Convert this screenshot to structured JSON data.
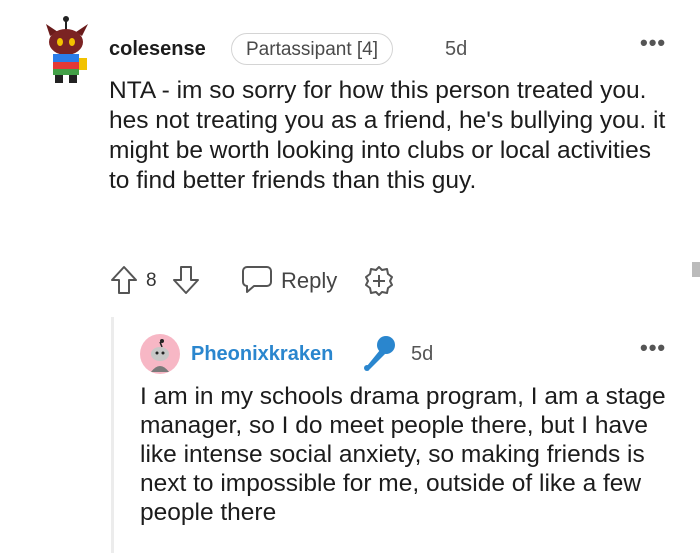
{
  "comments": [
    {
      "username": "colesense",
      "flair": "Partassipant [4]",
      "time": "5d",
      "more_label": "•••",
      "body": "NTA - im so sorry for how this person treated you. hes not treating you as a friend, he's bullying you. it might be worth looking into clubs or local activities to find better friends than this guy.",
      "score": "8",
      "reply_label": "Reply"
    },
    {
      "username": "Pheonixkraken",
      "time": "5d",
      "more_label": "•••",
      "body": "I am in my schools drama program, I am a stage manager, so I do meet people there, but I have like intense social anxiety, so making friends is next to impossible for me, outside of like a few people there"
    }
  ],
  "icons": {
    "upvote": "upvote-icon",
    "downvote": "downvote-icon",
    "reply": "reply-icon",
    "award": "award-icon",
    "mic": "microphone-icon",
    "more": "more-options-icon"
  },
  "colors": {
    "username_op": "#2a86ce",
    "mic_icon": "#2a86ce",
    "avatar2_bg": "#f7b7c5"
  }
}
